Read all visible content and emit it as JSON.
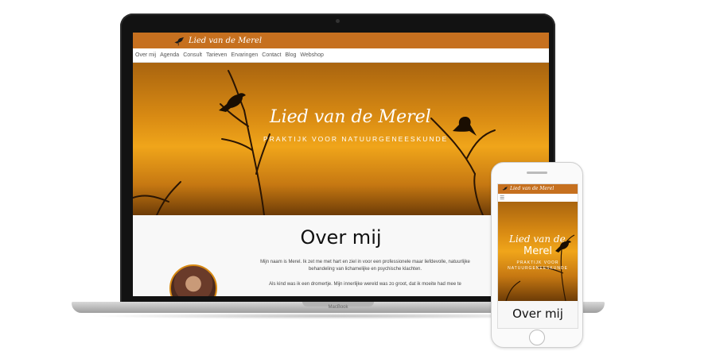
{
  "laptop": {
    "brand_name": "Lied van de Merel",
    "nav": [
      "Over mij",
      "Agenda",
      "Consult",
      "Tarieven",
      "Ervaringen",
      "Contact",
      "Blog",
      "Webshop"
    ],
    "hero_title": "Lied van de Merel",
    "hero_subtitle": "PRAKTIJK VOOR NATUURGENEESKUNDE",
    "about_title": "Over mij",
    "about_p1": "Mijn naam is Merel. Ik zet me met hart en ziel in voor een professionele maar liefdevolle, natuurlijke behandeling van lichamelijke en psychische klachten.",
    "about_p2": "Als kind was ik een dromertje. Mijn innerlijke wereld was zo groot, dat ik moeite had mee te",
    "device_label": "MacBook"
  },
  "phone": {
    "brand_name": "Lied van de Merel",
    "menu_icon": "hamburger-menu-icon",
    "hero_title_line1": "Lied van de",
    "hero_title_line2": "Merel",
    "hero_subtitle_line1": "PRAKTIJK VOOR",
    "hero_subtitle_line2": "NATUURGENEESKUNDE",
    "about_title": "Over mij"
  },
  "colors": {
    "brand_orange": "#c6701f",
    "hero_amber": "#f0a51a",
    "text_dark": "#111111"
  },
  "icons": [
    "blackbird-logo-icon",
    "hamburger-menu-icon"
  ]
}
